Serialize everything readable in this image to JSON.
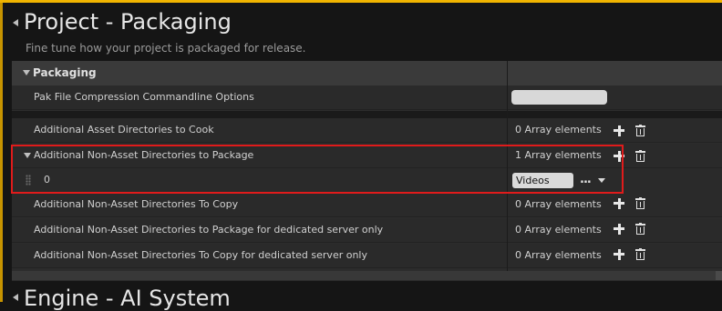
{
  "section": {
    "title": "Project - Packaging",
    "description": "Fine tune how your project is packaged for release."
  },
  "category": {
    "label": "Packaging"
  },
  "rows": [
    {
      "label": "Pak File Compression Commandline Options",
      "value": ""
    },
    {
      "label": "Additional Asset Directories to Cook",
      "value": "0 Array elements"
    },
    {
      "label": "Additional Non-Asset Directories to Package",
      "value": "1 Array elements"
    },
    {
      "label": "0",
      "value": "Videos"
    },
    {
      "label": "Additional Non-Asset Directories To Copy",
      "value": "0 Array elements"
    },
    {
      "label": "Additional Non-Asset Directories to Package for dedicated server only",
      "value": "0 Array elements"
    },
    {
      "label": "Additional Non-Asset Directories To Copy for dedicated server only",
      "value": "0 Array elements"
    }
  ],
  "element_menu": {
    "label": "..."
  },
  "next_section": {
    "title": "Engine - AI System"
  },
  "colors": {
    "accent": "#f0b400",
    "highlight": "#e01b1b",
    "background": "#151515"
  },
  "icons": [
    "collapse-icon",
    "add-element-icon",
    "delete-icon",
    "drag-handle-icon",
    "dropdown-arrow-icon"
  ]
}
